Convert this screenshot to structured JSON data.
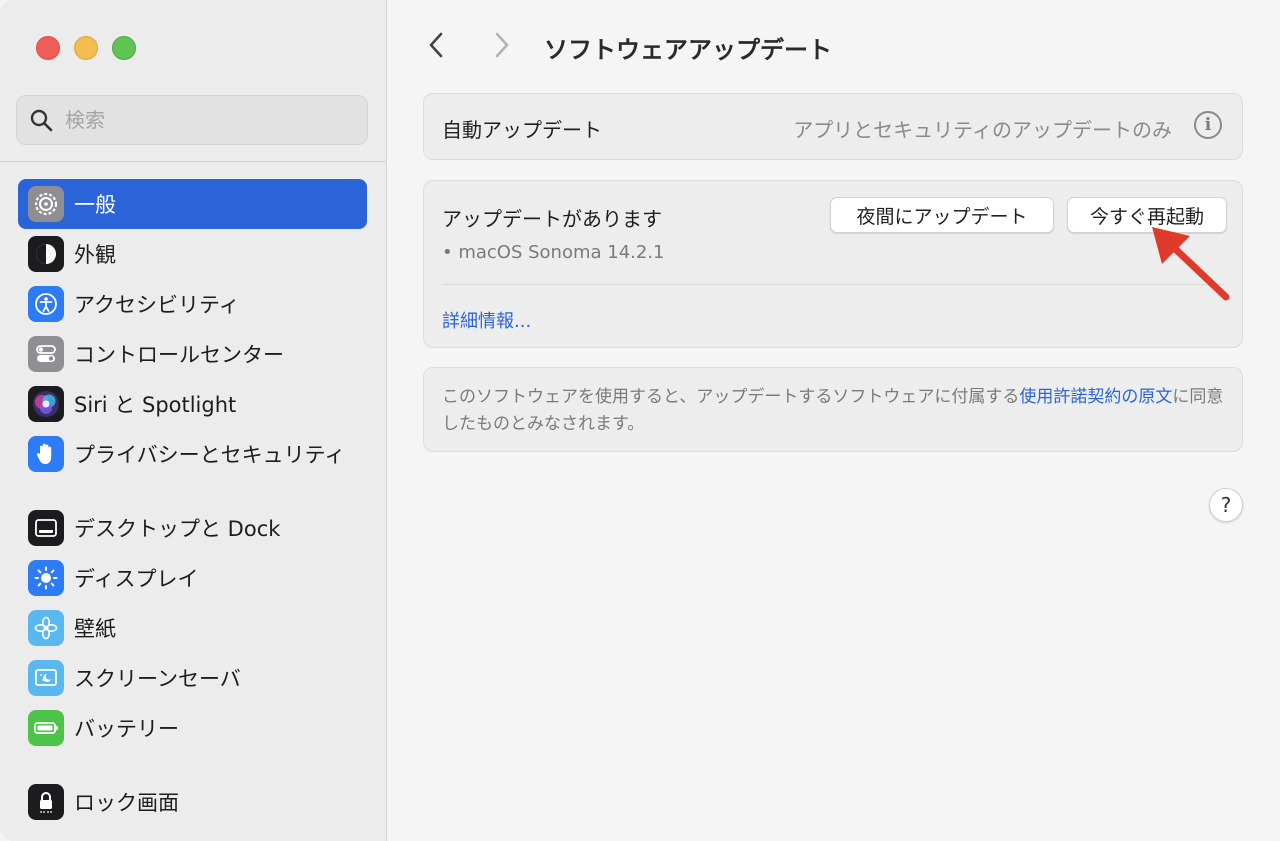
{
  "search": {
    "placeholder": "検索"
  },
  "sidebar": {
    "items": [
      {
        "label": "一般",
        "icon": "gear-icon",
        "color": "#8e8e93",
        "active": true
      },
      {
        "label": "外観",
        "icon": "appearance-icon",
        "color": "#1c1c1e"
      },
      {
        "label": "アクセシビリティ",
        "icon": "accessibility-icon",
        "color": "#2e7bf6"
      },
      {
        "label": "コントロールセンター",
        "icon": "control-center-icon",
        "color": "#8e8e93"
      },
      {
        "label": "Siri と Spotlight",
        "icon": "siri-icon",
        "color": "#5a3d9a"
      },
      {
        "label": "プライバシーとセキュリティ",
        "icon": "hand-icon",
        "color": "#2e7bf6"
      },
      {
        "label": "デスクトップと Dock",
        "icon": "dock-icon",
        "color": "#1c1c1e"
      },
      {
        "label": "ディスプレイ",
        "icon": "brightness-icon",
        "color": "#2e7bf6"
      },
      {
        "label": "壁紙",
        "icon": "flower-icon",
        "color": "#5ab8f0"
      },
      {
        "label": "スクリーンセーバ",
        "icon": "screensaver-icon",
        "color": "#5ab8f0"
      },
      {
        "label": "バッテリー",
        "icon": "battery-icon",
        "color": "#4cc44a"
      },
      {
        "label": "ロック画面",
        "icon": "lock-icon",
        "color": "#1c1c1e"
      }
    ]
  },
  "main": {
    "title": "ソフトウェアアップデート",
    "auto_update": {
      "label": "自動アップデート",
      "value": "アプリとセキュリティのアップデートのみ",
      "info": "i"
    },
    "update": {
      "title": "アップデートがあります",
      "night_button": "夜間にアップデート",
      "restart_button": "今すぐ再起動",
      "item": "• macOS Sonoma 14.2.1",
      "more_link": "詳細情報..."
    },
    "license": {
      "text_before": "このソフトウェアを使用すると、アップデートするソフトウェアに付属する",
      "link": "使用許諾契約の原文",
      "text_after": "に同意したものとみなされます。"
    },
    "help": "?"
  },
  "colors": {
    "accent": "#2b64d9",
    "annotation_arrow": "#e03a2b"
  }
}
